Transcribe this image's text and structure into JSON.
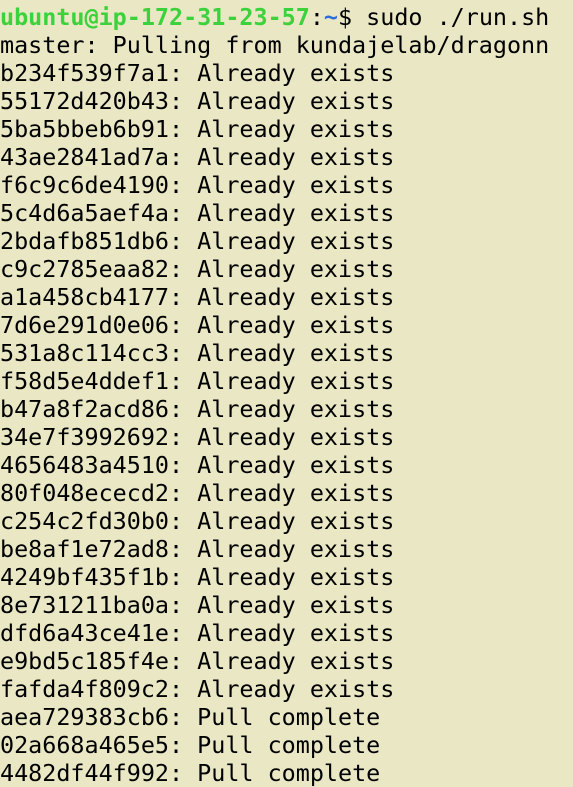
{
  "prompt": {
    "user_host": "ubuntu@ip-172-31-23-57",
    "colon": ":",
    "path": "~",
    "symbol": "$ ",
    "command": "sudo ./run.sh"
  },
  "colors": {
    "background": "#e9e7c4",
    "prompt_user": "#3bd23b",
    "prompt_path": "#2c6ed8",
    "text": "#000000"
  },
  "output_header": "master: Pulling from kundajelab/dragonn",
  "layers": [
    {
      "id": "b234f539f7a1",
      "status": "Already exists"
    },
    {
      "id": "55172d420b43",
      "status": "Already exists"
    },
    {
      "id": "5ba5bbeb6b91",
      "status": "Already exists"
    },
    {
      "id": "43ae2841ad7a",
      "status": "Already exists"
    },
    {
      "id": "f6c9c6de4190",
      "status": "Already exists"
    },
    {
      "id": "5c4d6a5aef4a",
      "status": "Already exists"
    },
    {
      "id": "2bdafb851db6",
      "status": "Already exists"
    },
    {
      "id": "c9c2785eaa82",
      "status": "Already exists"
    },
    {
      "id": "a1a458cb4177",
      "status": "Already exists"
    },
    {
      "id": "7d6e291d0e06",
      "status": "Already exists"
    },
    {
      "id": "531a8c114cc3",
      "status": "Already exists"
    },
    {
      "id": "f58d5e4ddef1",
      "status": "Already exists"
    },
    {
      "id": "b47a8f2acd86",
      "status": "Already exists"
    },
    {
      "id": "34e7f3992692",
      "status": "Already exists"
    },
    {
      "id": "4656483a4510",
      "status": "Already exists"
    },
    {
      "id": "80f048ececd2",
      "status": "Already exists"
    },
    {
      "id": "c254c2fd30b0",
      "status": "Already exists"
    },
    {
      "id": "be8af1e72ad8",
      "status": "Already exists"
    },
    {
      "id": "4249bf435f1b",
      "status": "Already exists"
    },
    {
      "id": "8e731211ba0a",
      "status": "Already exists"
    },
    {
      "id": "dfd6a43ce41e",
      "status": "Already exists"
    },
    {
      "id": "e9bd5c185f4e",
      "status": "Already exists"
    },
    {
      "id": "fafda4f809c2",
      "status": "Already exists"
    },
    {
      "id": "aea729383cb6",
      "status": "Pull complete"
    },
    {
      "id": "02a668a465e5",
      "status": "Pull complete"
    },
    {
      "id": "4482df44f992",
      "status": "Pull complete"
    }
  ]
}
